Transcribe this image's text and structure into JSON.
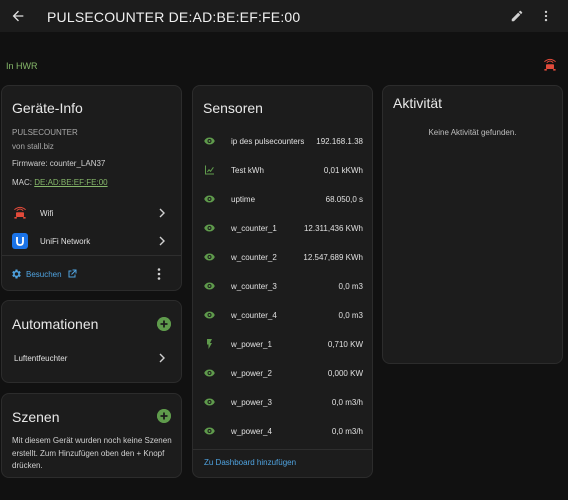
{
  "header": {
    "title": "PULSECOUNTER DE:AD:BE:EF:FE:00"
  },
  "area": {
    "label": "In HWR"
  },
  "device_info": {
    "title": "Geräte-Info",
    "model": "PULSECOUNTER",
    "manufacturer": "von stall.biz",
    "firmware": "Firmware: counter_LAN37",
    "mac_label": "MAC:",
    "mac_value": "DE:AD:BE:EF:FE:00",
    "connections": [
      {
        "label": "Wifi",
        "icon": "wifi-router-icon"
      },
      {
        "label": "UniFi Network",
        "icon": "unifi-logo-icon"
      }
    ],
    "visit_label": "Besuchen"
  },
  "automations": {
    "title": "Automationen",
    "items": [
      {
        "label": "Luftentfeuchter"
      }
    ]
  },
  "scenes": {
    "title": "Szenen",
    "empty_text": "Mit diesem Gerät wurden noch keine Szenen erstellt. Zum Hinzufügen oben den + Knopf drücken."
  },
  "sensors": {
    "title": "Sensoren",
    "items": [
      {
        "name": "ip des pulsecounters",
        "value": "192.168.1.38",
        "icon": "eye-icon"
      },
      {
        "name": "Test kWh",
        "value": "0,01 kKWh",
        "icon": "chart-icon"
      },
      {
        "name": "uptime",
        "value": "68.050,0 s",
        "icon": "eye-icon"
      },
      {
        "name": "w_counter_1",
        "value": "12.311,436 KWh",
        "icon": "eye-icon"
      },
      {
        "name": "w_counter_2",
        "value": "12.547,689 KWh",
        "icon": "eye-icon"
      },
      {
        "name": "w_counter_3",
        "value": "0,0 m3",
        "icon": "eye-icon"
      },
      {
        "name": "w_counter_4",
        "value": "0,0 m3",
        "icon": "eye-icon"
      },
      {
        "name": "w_power_1",
        "value": "0,710 KW",
        "icon": "flash-icon"
      },
      {
        "name": "w_power_2",
        "value": "0,000 KW",
        "icon": "eye-icon"
      },
      {
        "name": "w_power_3",
        "value": "0,0 m3/h",
        "icon": "eye-icon"
      },
      {
        "name": "w_power_4",
        "value": "0,0 m3/h",
        "icon": "eye-icon"
      }
    ],
    "dashboard_label": "Zu Dashboard hinzufügen"
  },
  "activity": {
    "title": "Aktivität",
    "empty_text": "Keine Aktivität gefunden."
  },
  "colors": {
    "background": "#111111",
    "card": "#1c1c1c",
    "icon_green": "#5f9b4c",
    "link_blue": "#4fa3e0",
    "area_green": "#86b86a"
  }
}
